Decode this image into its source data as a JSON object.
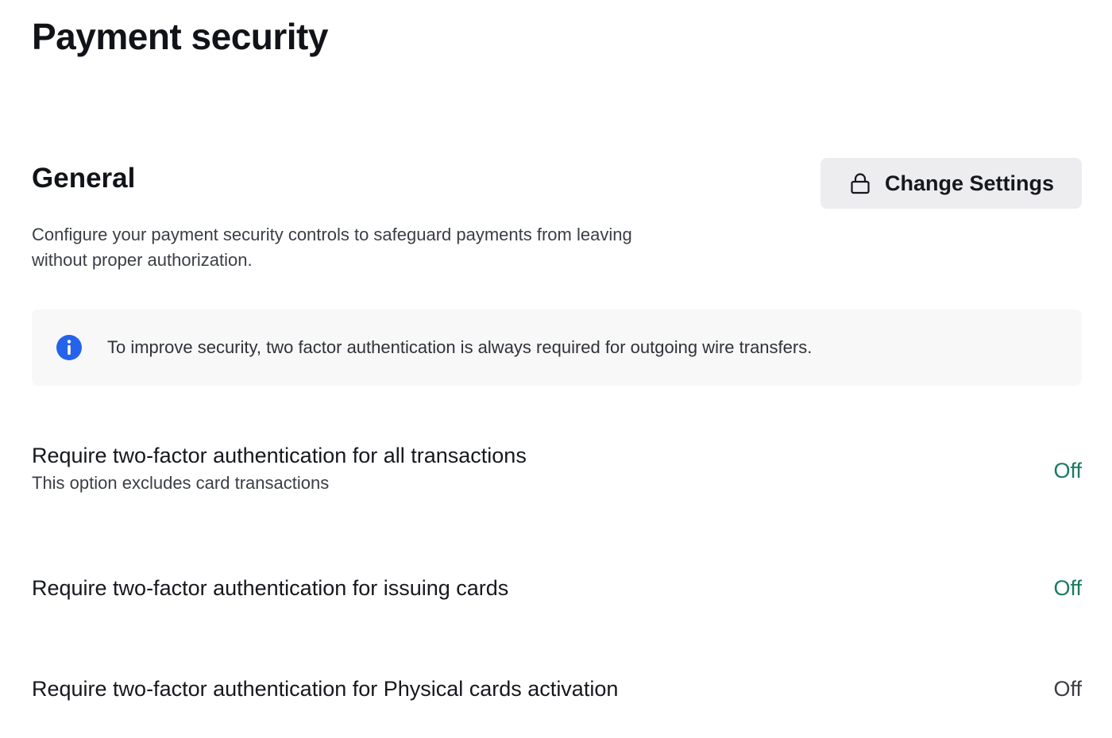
{
  "page": {
    "title": "Payment security"
  },
  "general": {
    "title": "General",
    "change_settings_label": "Change Settings",
    "description": "Configure your payment security controls to safeguard payments from leaving without proper authorization.",
    "info_banner": {
      "icon": "info-icon",
      "text": "To improve security, two factor authentication is always required for outgoing wire transfers.",
      "icon_color": "#2563eb"
    }
  },
  "settings": [
    {
      "title": "Require two-factor authentication for all transactions",
      "subtitle": "This option excludes card transactions",
      "status": "Off",
      "status_color": "#1a7a5e"
    },
    {
      "title": "Require two-factor authentication for issuing cards",
      "subtitle": "",
      "status": "Off",
      "status_color": "#1a7a5e"
    },
    {
      "title": "Require two-factor authentication for Physical cards activation",
      "subtitle": "",
      "status": "Off",
      "status_color": "#3b3e45"
    }
  ]
}
